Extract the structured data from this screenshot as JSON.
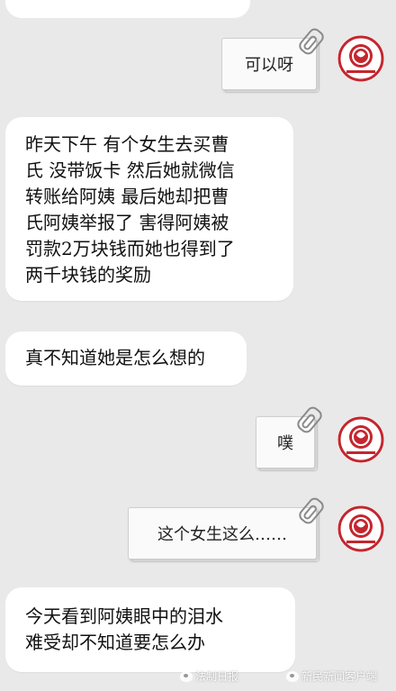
{
  "messages": [
    {
      "id": "m1",
      "side": "right",
      "text": "可以呀"
    },
    {
      "id": "m2",
      "side": "left",
      "lines": [
        "昨天下午 有个女生去买曹",
        "氏 没带饭卡 然后她就微信",
        "转账给阿姨  最后她却把曹",
        "氏阿姨举报了  害得阿姨被",
        "罚款2万块钱而她也得到了",
        "两千块钱的奖励"
      ]
    },
    {
      "id": "m3",
      "side": "left",
      "text": "真不知道她是怎么想的"
    },
    {
      "id": "m4",
      "side": "right",
      "text": "噗"
    },
    {
      "id": "m5",
      "side": "right",
      "text": "这个女生这么……"
    },
    {
      "id": "m6",
      "side": "left",
      "lines": [
        "今天看到阿姨眼中的泪水",
        "难受却不知道要怎么办"
      ]
    }
  ],
  "avatar": {
    "icon": "red-seal-logo-icon",
    "color": "#c4262e"
  },
  "watermarks": [
    {
      "text": "法制日报"
    },
    {
      "text": "新民新闻客户端"
    }
  ]
}
